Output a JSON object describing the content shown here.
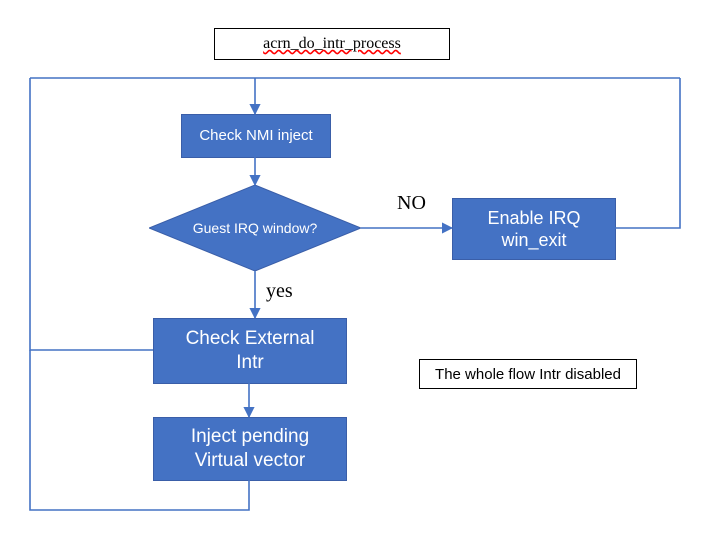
{
  "title": "acrn_do_intr_process",
  "nodes": {
    "check_nmi": "Check NMI inject",
    "guest_irq": "Guest IRQ window?",
    "enable_irq": "Enable IRQ\nwin_exit",
    "check_ext": "Check External\nIntr",
    "inject_pending": "Inject pending\nVirtual vector"
  },
  "edges": {
    "no": "NO",
    "yes": "yes"
  },
  "note": "The whole flow Intr disabled",
  "chart_data": {
    "type": "flowchart",
    "title": "acrn_do_intr_process",
    "nodes": [
      {
        "id": "check_nmi",
        "label": "Check NMI inject",
        "shape": "process"
      },
      {
        "id": "guest_irq",
        "label": "Guest IRQ window?",
        "shape": "decision"
      },
      {
        "id": "enable_irq",
        "label": "Enable IRQ win_exit",
        "shape": "process"
      },
      {
        "id": "check_ext",
        "label": "Check External Intr",
        "shape": "process"
      },
      {
        "id": "inject_pending",
        "label": "Inject pending Virtual vector",
        "shape": "process"
      }
    ],
    "edges": [
      {
        "from": "start_loop_top",
        "to": "check_nmi"
      },
      {
        "from": "check_nmi",
        "to": "guest_irq"
      },
      {
        "from": "guest_irq",
        "to": "enable_irq",
        "label": "NO"
      },
      {
        "from": "guest_irq",
        "to": "check_ext",
        "label": "yes"
      },
      {
        "from": "enable_irq",
        "to": "start_loop_top",
        "note": "loops back to top"
      },
      {
        "from": "check_ext",
        "to": "start_loop_top",
        "note": "loops back to top (left path)"
      },
      {
        "from": "check_ext",
        "to": "inject_pending"
      },
      {
        "from": "inject_pending",
        "to": "start_loop_top",
        "note": "loops back to top (bottom path)"
      }
    ],
    "annotation": "The whole flow Intr disabled"
  }
}
